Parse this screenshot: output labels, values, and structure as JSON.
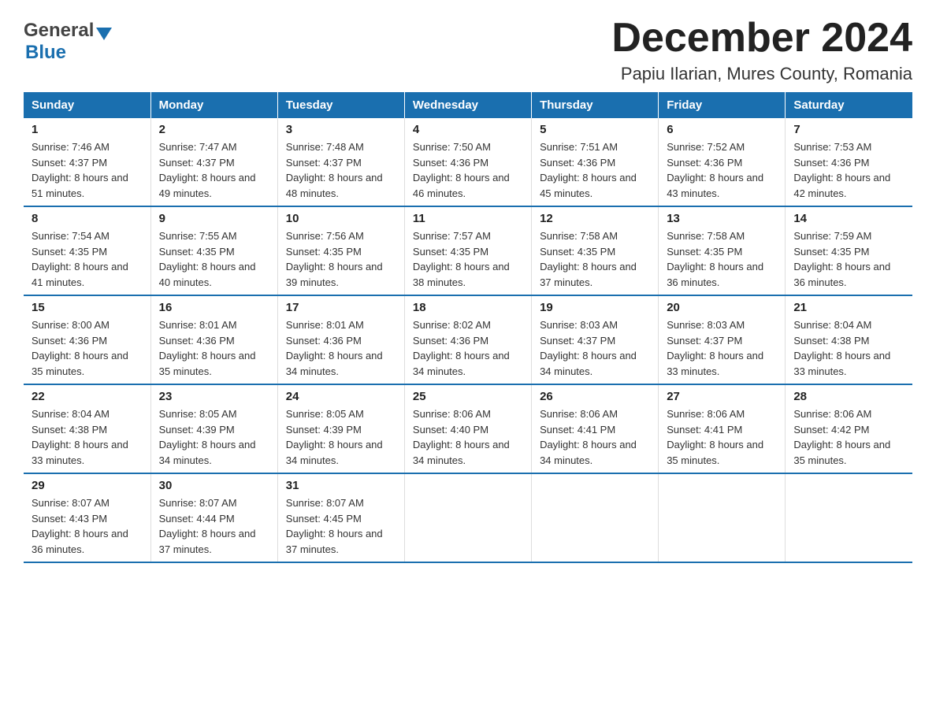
{
  "header": {
    "title": "December 2024",
    "subtitle": "Papiu Ilarian, Mures County, Romania",
    "logo_general": "General",
    "logo_blue": "Blue"
  },
  "weekdays": [
    "Sunday",
    "Monday",
    "Tuesday",
    "Wednesday",
    "Thursday",
    "Friday",
    "Saturday"
  ],
  "weeks": [
    {
      "days": [
        {
          "num": "1",
          "sunrise": "7:46 AM",
          "sunset": "4:37 PM",
          "daylight": "8 hours and 51 minutes."
        },
        {
          "num": "2",
          "sunrise": "7:47 AM",
          "sunset": "4:37 PM",
          "daylight": "8 hours and 49 minutes."
        },
        {
          "num": "3",
          "sunrise": "7:48 AM",
          "sunset": "4:37 PM",
          "daylight": "8 hours and 48 minutes."
        },
        {
          "num": "4",
          "sunrise": "7:50 AM",
          "sunset": "4:36 PM",
          "daylight": "8 hours and 46 minutes."
        },
        {
          "num": "5",
          "sunrise": "7:51 AM",
          "sunset": "4:36 PM",
          "daylight": "8 hours and 45 minutes."
        },
        {
          "num": "6",
          "sunrise": "7:52 AM",
          "sunset": "4:36 PM",
          "daylight": "8 hours and 43 minutes."
        },
        {
          "num": "7",
          "sunrise": "7:53 AM",
          "sunset": "4:36 PM",
          "daylight": "8 hours and 42 minutes."
        }
      ]
    },
    {
      "days": [
        {
          "num": "8",
          "sunrise": "7:54 AM",
          "sunset": "4:35 PM",
          "daylight": "8 hours and 41 minutes."
        },
        {
          "num": "9",
          "sunrise": "7:55 AM",
          "sunset": "4:35 PM",
          "daylight": "8 hours and 40 minutes."
        },
        {
          "num": "10",
          "sunrise": "7:56 AM",
          "sunset": "4:35 PM",
          "daylight": "8 hours and 39 minutes."
        },
        {
          "num": "11",
          "sunrise": "7:57 AM",
          "sunset": "4:35 PM",
          "daylight": "8 hours and 38 minutes."
        },
        {
          "num": "12",
          "sunrise": "7:58 AM",
          "sunset": "4:35 PM",
          "daylight": "8 hours and 37 minutes."
        },
        {
          "num": "13",
          "sunrise": "7:58 AM",
          "sunset": "4:35 PM",
          "daylight": "8 hours and 36 minutes."
        },
        {
          "num": "14",
          "sunrise": "7:59 AM",
          "sunset": "4:35 PM",
          "daylight": "8 hours and 36 minutes."
        }
      ]
    },
    {
      "days": [
        {
          "num": "15",
          "sunrise": "8:00 AM",
          "sunset": "4:36 PM",
          "daylight": "8 hours and 35 minutes."
        },
        {
          "num": "16",
          "sunrise": "8:01 AM",
          "sunset": "4:36 PM",
          "daylight": "8 hours and 35 minutes."
        },
        {
          "num": "17",
          "sunrise": "8:01 AM",
          "sunset": "4:36 PM",
          "daylight": "8 hours and 34 minutes."
        },
        {
          "num": "18",
          "sunrise": "8:02 AM",
          "sunset": "4:36 PM",
          "daylight": "8 hours and 34 minutes."
        },
        {
          "num": "19",
          "sunrise": "8:03 AM",
          "sunset": "4:37 PM",
          "daylight": "8 hours and 34 minutes."
        },
        {
          "num": "20",
          "sunrise": "8:03 AM",
          "sunset": "4:37 PM",
          "daylight": "8 hours and 33 minutes."
        },
        {
          "num": "21",
          "sunrise": "8:04 AM",
          "sunset": "4:38 PM",
          "daylight": "8 hours and 33 minutes."
        }
      ]
    },
    {
      "days": [
        {
          "num": "22",
          "sunrise": "8:04 AM",
          "sunset": "4:38 PM",
          "daylight": "8 hours and 33 minutes."
        },
        {
          "num": "23",
          "sunrise": "8:05 AM",
          "sunset": "4:39 PM",
          "daylight": "8 hours and 34 minutes."
        },
        {
          "num": "24",
          "sunrise": "8:05 AM",
          "sunset": "4:39 PM",
          "daylight": "8 hours and 34 minutes."
        },
        {
          "num": "25",
          "sunrise": "8:06 AM",
          "sunset": "4:40 PM",
          "daylight": "8 hours and 34 minutes."
        },
        {
          "num": "26",
          "sunrise": "8:06 AM",
          "sunset": "4:41 PM",
          "daylight": "8 hours and 34 minutes."
        },
        {
          "num": "27",
          "sunrise": "8:06 AM",
          "sunset": "4:41 PM",
          "daylight": "8 hours and 35 minutes."
        },
        {
          "num": "28",
          "sunrise": "8:06 AM",
          "sunset": "4:42 PM",
          "daylight": "8 hours and 35 minutes."
        }
      ]
    },
    {
      "days": [
        {
          "num": "29",
          "sunrise": "8:07 AM",
          "sunset": "4:43 PM",
          "daylight": "8 hours and 36 minutes."
        },
        {
          "num": "30",
          "sunrise": "8:07 AM",
          "sunset": "4:44 PM",
          "daylight": "8 hours and 37 minutes."
        },
        {
          "num": "31",
          "sunrise": "8:07 AM",
          "sunset": "4:45 PM",
          "daylight": "8 hours and 37 minutes."
        },
        {
          "num": "",
          "sunrise": "",
          "sunset": "",
          "daylight": ""
        },
        {
          "num": "",
          "sunrise": "",
          "sunset": "",
          "daylight": ""
        },
        {
          "num": "",
          "sunrise": "",
          "sunset": "",
          "daylight": ""
        },
        {
          "num": "",
          "sunrise": "",
          "sunset": "",
          "daylight": ""
        }
      ]
    }
  ],
  "labels": {
    "sunrise": "Sunrise:",
    "sunset": "Sunset:",
    "daylight": "Daylight:"
  }
}
